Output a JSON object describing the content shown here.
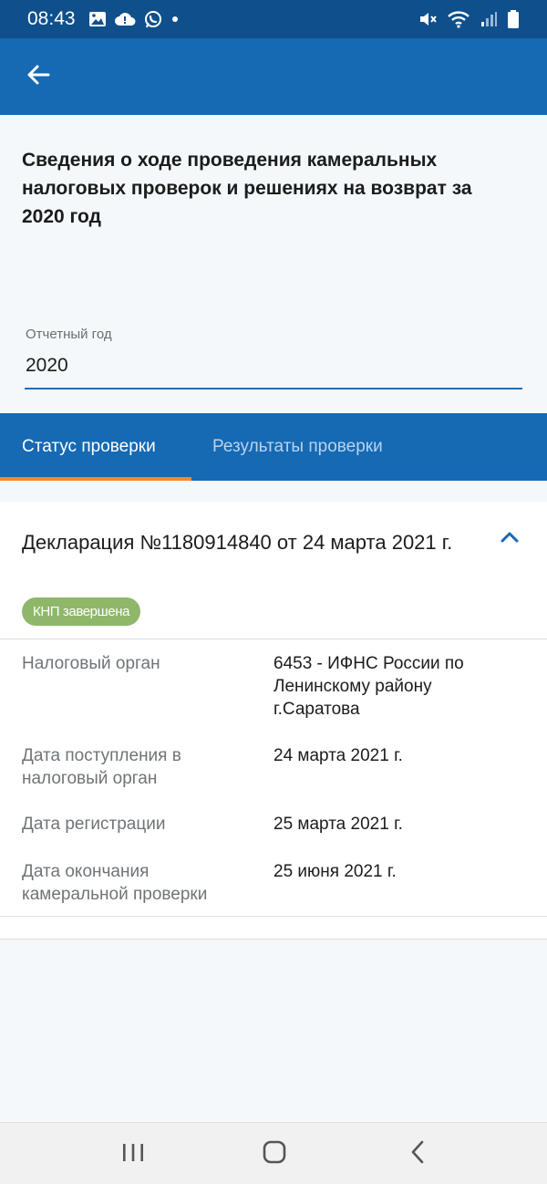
{
  "status_bar": {
    "time": "08:43",
    "icons": [
      "image-icon",
      "cloud-alert-icon",
      "whatsapp-icon",
      "dot-icon",
      "mute-icon",
      "wifi-icon",
      "signal-icon",
      "battery-icon"
    ]
  },
  "header": {
    "title": "Сведения о ходе проведения камеральных налоговых проверок и решениях на возврат за 2020 год"
  },
  "report_year": {
    "label": "Отчетный год",
    "value": "2020"
  },
  "tabs": [
    {
      "label": "Статус проверки",
      "active": true
    },
    {
      "label": "Результаты проверки",
      "active": false
    }
  ],
  "declaration": {
    "title": "Декларация №1180914840 от 24 марта 2021 г.",
    "status_badge": "КНП завершена",
    "rows": [
      {
        "label": "Налоговый орган",
        "value": "6453 - ИФНС России по Ленинскому району г.Саратова"
      },
      {
        "label": "Дата поступления в налоговый орган",
        "value": "24 марта 2021 г."
      },
      {
        "label": "Дата регистрации",
        "value": "25 марта 2021 г."
      },
      {
        "label": "Дата окончания камеральной проверки",
        "value": "25 июня 2021 г."
      }
    ]
  },
  "colors": {
    "status_bar": "#0f4f8c",
    "app_bar": "#1669b3",
    "tab_indicator": "#f08a2c",
    "badge": "#8fb76a",
    "accent": "#1f6fb5"
  }
}
